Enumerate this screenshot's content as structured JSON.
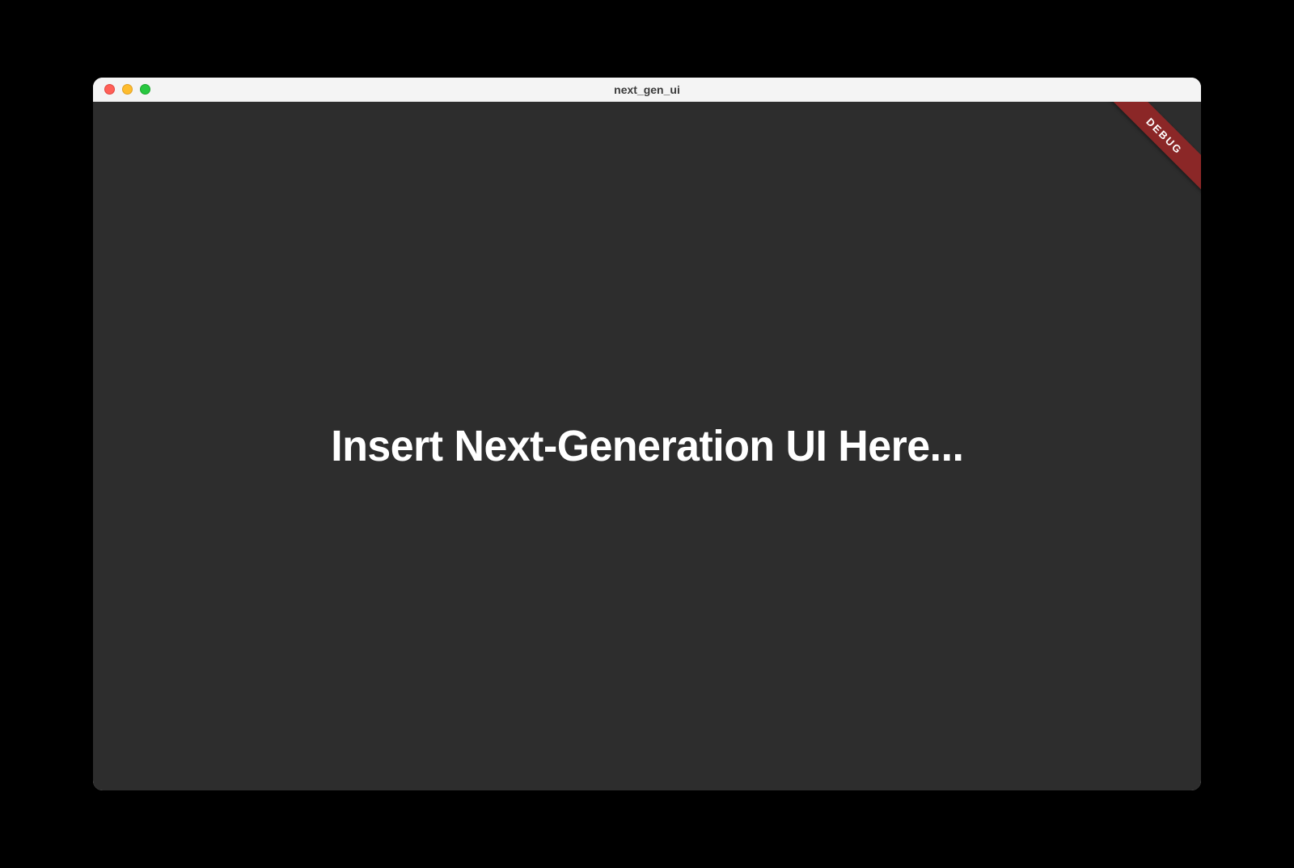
{
  "window": {
    "title": "next_gen_ui"
  },
  "content": {
    "headline": "Insert Next-Generation UI Here..."
  },
  "ribbon": {
    "label": "DEBUG"
  }
}
